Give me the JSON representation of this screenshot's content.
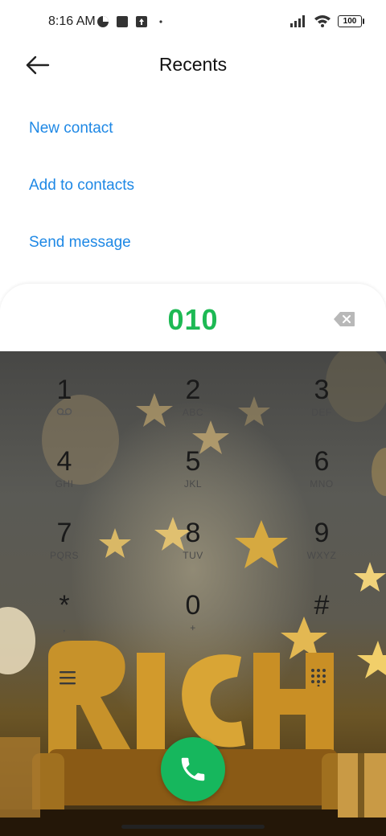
{
  "status_bar": {
    "time": "8:16 AM",
    "battery": "100",
    "icons": [
      "data-saver-icon",
      "notification-square-icon",
      "upload-box-icon",
      "dot-icon",
      "signal-icon",
      "wifi-icon",
      "battery-icon"
    ]
  },
  "header": {
    "title": "Recents",
    "back_icon": "arrow-left-icon"
  },
  "actions": [
    {
      "label": "New contact"
    },
    {
      "label": "Add to contacts"
    },
    {
      "label": "Send message"
    }
  ],
  "dialer": {
    "number": "010",
    "keys": [
      {
        "digit": "1",
        "letters": ""
      },
      {
        "digit": "2",
        "letters": "ABC"
      },
      {
        "digit": "3",
        "letters": "DEF"
      },
      {
        "digit": "4",
        "letters": "GHI"
      },
      {
        "digit": "5",
        "letters": "JKL"
      },
      {
        "digit": "6",
        "letters": "MNO"
      },
      {
        "digit": "7",
        "letters": "PQRS"
      },
      {
        "digit": "8",
        "letters": "TUV"
      },
      {
        "digit": "9",
        "letters": "WXYZ"
      },
      {
        "digit": "*",
        "letters": ","
      },
      {
        "digit": "0",
        "letters": "+"
      },
      {
        "digit": "#",
        "letters": ""
      }
    ]
  },
  "colors": {
    "accent": "#1e88e5",
    "number": "#1db954",
    "call": "#16b75d"
  }
}
